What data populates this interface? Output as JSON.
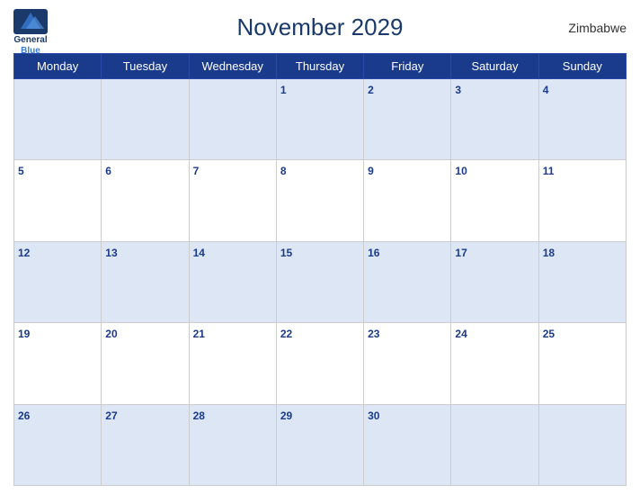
{
  "header": {
    "title": "November 2029",
    "country": "Zimbabwe",
    "logo": {
      "line1": "General",
      "line2": "Blue"
    }
  },
  "days_of_week": [
    "Monday",
    "Tuesday",
    "Wednesday",
    "Thursday",
    "Friday",
    "Saturday",
    "Sunday"
  ],
  "weeks": [
    [
      null,
      null,
      null,
      1,
      2,
      3,
      4
    ],
    [
      5,
      6,
      7,
      8,
      9,
      10,
      11
    ],
    [
      12,
      13,
      14,
      15,
      16,
      17,
      18
    ],
    [
      19,
      20,
      21,
      22,
      23,
      24,
      25
    ],
    [
      26,
      27,
      28,
      29,
      30,
      null,
      null
    ]
  ]
}
